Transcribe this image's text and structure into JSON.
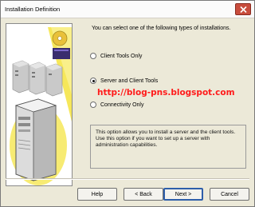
{
  "window": {
    "title": "Installation Definition"
  },
  "instructions": "You can select one of the following types of installations.",
  "options": [
    {
      "label": "Client Tools Only",
      "selected": false
    },
    {
      "label": "Server and Client Tools",
      "selected": true
    },
    {
      "label": "Connectivity Only",
      "selected": false
    }
  ],
  "watermark": "http://blog-pns.blogspot.com",
  "description": "This option allows you to install a server and the client tools. Use this option if you want to set up a server with administration capabilities.",
  "buttons": {
    "help": "Help",
    "back": "< Back",
    "next": "Next >",
    "cancel": "Cancel"
  },
  "icons": {
    "close": "close-icon",
    "side": "servers-illustration"
  }
}
